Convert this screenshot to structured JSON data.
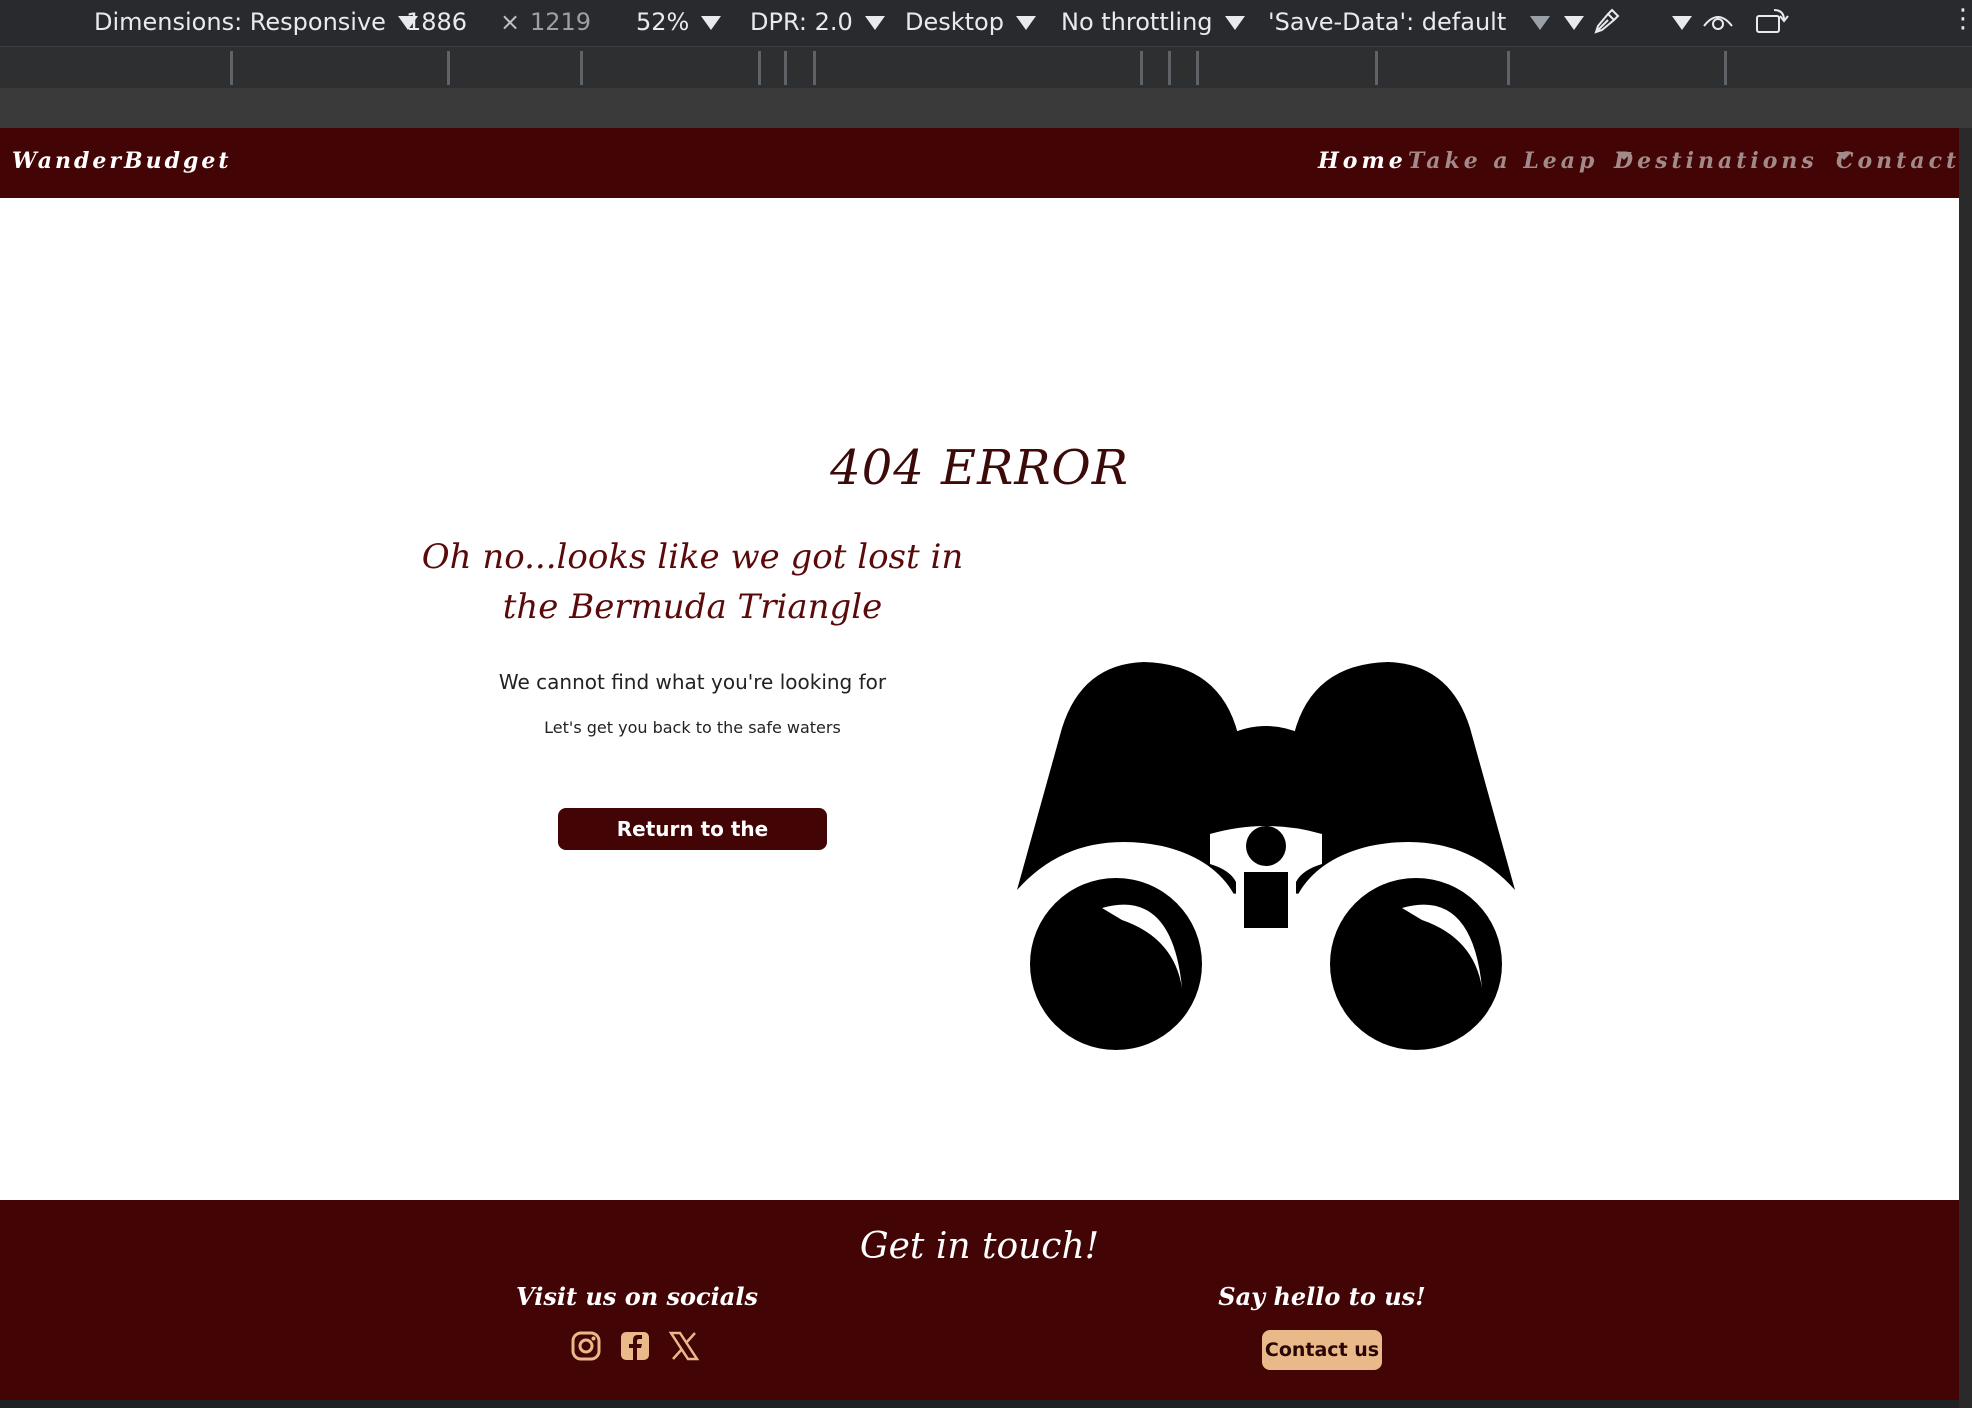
{
  "devtools": {
    "dimensions": "Dimensions: Responsive",
    "width": "1886",
    "times": "×",
    "height": "1219",
    "zoom": "52%",
    "dpr": "DPR: 2.0",
    "device": "Desktop",
    "throttling": "No throttling",
    "save_data": "'Save-Data': default"
  },
  "site": {
    "brand": "WanderBudget",
    "nav": {
      "home": "Home",
      "leap": "Take a Leap",
      "destinations": "Destinations",
      "contact": "Contact"
    }
  },
  "main": {
    "title": "404 ERROR",
    "lost_line1": "Oh no...looks like we got lost in",
    "lost_line2": "the Bermuda Triangle",
    "cannot_find": "We cannot find what you're looking for",
    "safe_waters": "Let's get you back to the safe waters",
    "home_button": "Return to the Homepage"
  },
  "footer": {
    "title": "Get in touch!",
    "socials_heading": "Visit us on socials",
    "hello_heading": "Say hello to us!",
    "contact_button": "Contact us",
    "icons": [
      "instagram-icon",
      "facebook-icon",
      "x-twitter-icon"
    ]
  },
  "colors": {
    "brand": "#420404",
    "accent": "#e9b98a",
    "nav_inactive": "#a38a8a"
  }
}
